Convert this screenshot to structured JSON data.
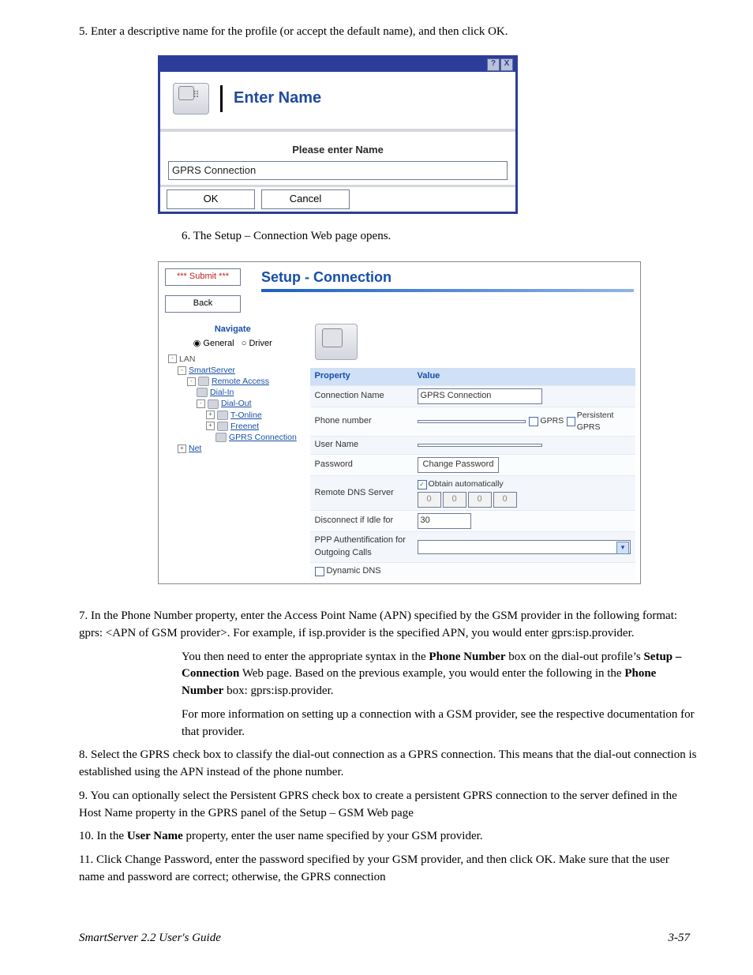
{
  "step5": "5.   Enter a descriptive name for the profile (or accept the default name), and then click OK.",
  "dialog1": {
    "title": "Enter Name",
    "help_btn": "?",
    "close_btn": "X",
    "prompt": "Please enter Name",
    "value": "GPRS Connection",
    "ok": "OK",
    "cancel": "Cancel"
  },
  "step6": "6.   The Setup – Connection Web page opens.",
  "dialog2": {
    "submit": "*** Submit ***",
    "back": "Back",
    "title": "Setup - Connection",
    "nav_header": "Navigate",
    "radio_general": "General",
    "radio_driver": "Driver",
    "tree": {
      "lan": "LAN",
      "smartserver": "SmartServer",
      "remote_access": "Remote Access",
      "dial_in": "Dial-In",
      "dial_out": "Dial-Out",
      "t_online": "T-Online",
      "freenet": "Freenet",
      "gprs_connection": "GPRS Connection",
      "net": "Net"
    },
    "grid": {
      "hdr_property": "Property",
      "hdr_value": "Value",
      "conn_name_lbl": "Connection Name",
      "conn_name_val": "GPRS Connection",
      "phone_lbl": "Phone number",
      "phone_val": "",
      "gprs_chk": "GPRS",
      "persistent_chk": "Persistent GPRS",
      "user_lbl": "User Name",
      "user_val": "",
      "pass_lbl": "Password",
      "pass_btn": "Change Password",
      "dns_lbl": "Remote DNS Server",
      "dns_auto": "Obtain automatically",
      "dns_octet": "0",
      "idle_lbl": "Disconnect if Idle for",
      "idle_val": "30",
      "ppp_lbl": "PPP Authentification for Outgoing Calls",
      "dyndns_lbl": "Dynamic DNS"
    }
  },
  "step7a": "7.   In the Phone Number property, enter the Access Point Name (APN) specified by the GSM provider in the following format:  gprs: ",
  "step7_apn": "<APN of GSM provider>",
  "step7b": ".   For example, if isp.provider is the specified APN, you would enter gprs:isp.provider.",
  "step7c_lead": "You then need to enter the appropriate syntax in the ",
  "step7c_bold1": "Phone Number",
  "step7c_mid": " box on the dial-out profile’s ",
  "step7c_bold2": "Setup – Connection",
  "step7c_tail_a": " Web page.  Based on the previous example, you would enter the following in the ",
  "step7c_bold3": "Phone Number",
  "step7c_tail_b": " box: gprs:isp.provider.",
  "step7d": "For more information on setting up a connection with a GSM provider, see the respective documentation for that provider.",
  "step8": "8.   Select the GPRS check box to classify the dial-out connection as a GPRS connection.   This means that the dial-out connection is established using the APN instead of the phone number.",
  "step9": "9.   You can optionally select the Persistent GPRS check box to create a persistent GPRS connection to the server defined in the Host Name property in the GPRS panel of the Setup – GSM Web page",
  "step10_a": "10.  In the ",
  "step10_bold": "User Name",
  "step10_b": " property, enter the user name specified by your GSM provider.",
  "step11": "11.  Click Change Password, enter the password specified by your GSM provider, and then click OK.  Make sure that the user name and password are correct; otherwise, the GPRS connection",
  "footer_left": "SmartServer 2.2 User's Guide",
  "footer_right": "3-57"
}
